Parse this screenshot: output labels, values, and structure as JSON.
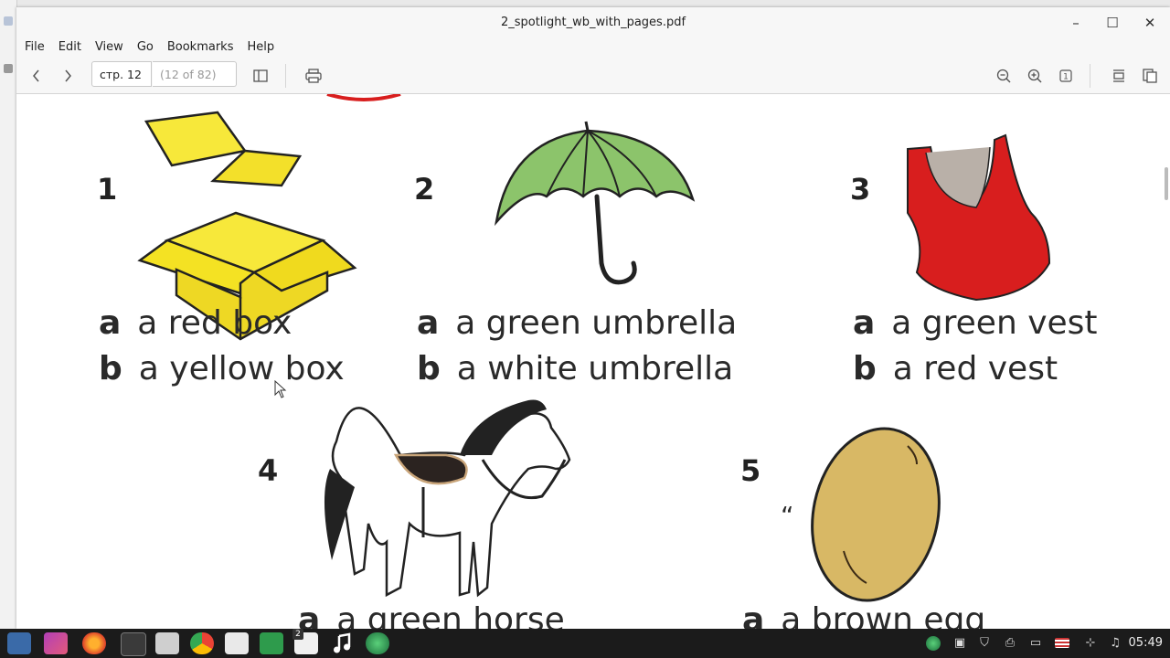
{
  "window": {
    "title": "2_spotlight_wb_with_pages.pdf",
    "controls": {
      "minimize": "–",
      "maximize": "☐",
      "close": "✕"
    }
  },
  "menu": [
    "File",
    "Edit",
    "View",
    "Go",
    "Bookmarks",
    "Help"
  ],
  "toolbar": {
    "page_entry_value": "стр. 12",
    "page_count": "(12 of 82)"
  },
  "document": {
    "items": [
      {
        "number": "1",
        "a": "a red box",
        "b": "a yellow box"
      },
      {
        "number": "2",
        "a": "a green umbrella",
        "b": "a white umbrella"
      },
      {
        "number": "3",
        "a": "a green vest",
        "b": "a red vest"
      },
      {
        "number": "4",
        "a": "a green horse"
      },
      {
        "number": "5",
        "a": "a brown egg"
      }
    ],
    "letter_a": "a",
    "letter_b": "b",
    "mark": "“"
  },
  "taskbar": {
    "clock": "05:49",
    "badge": "2"
  },
  "colors": {
    "taskbar_bg": "#1b1b1b",
    "toolbar_bg": "#f7f7f7",
    "box": "#f4e223",
    "umbrella": "#8cc46b",
    "vest": "#d81e1e",
    "egg": "#d8b865"
  }
}
